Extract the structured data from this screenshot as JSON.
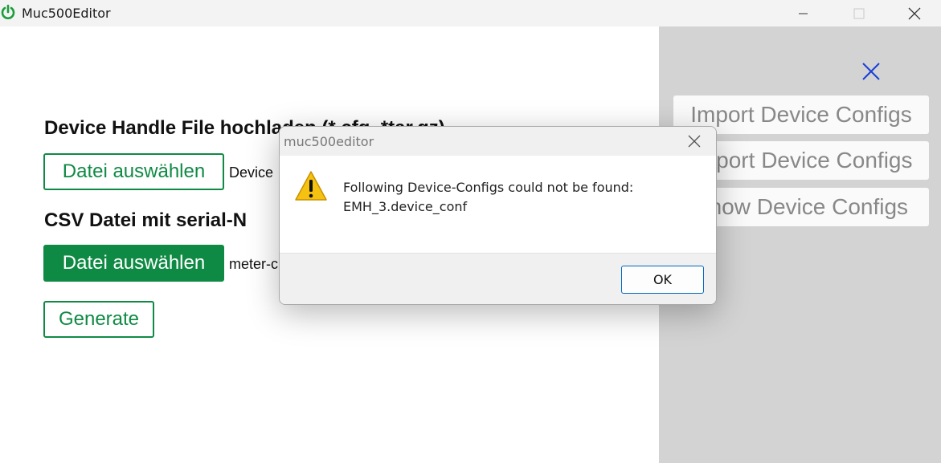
{
  "window": {
    "title": "Muc500Editor",
    "icon": "power-icon",
    "accent_color": "#1a9c3c"
  },
  "main": {
    "heading_device_file": "Device Handle File hochladen (*.cfg, *tar.gz)",
    "choose_file_button_1": "Datei auswählen",
    "file_label_1": "Device",
    "heading_csv": "CSV Datei mit serial-N",
    "choose_file_button_2": "Datei auswählen",
    "file_label_2": "meter-c",
    "generate_button": "Generate",
    "button_color": "#0f8a44"
  },
  "side_panel": {
    "close_icon": "close-icon",
    "close_icon_color": "#1a3fd8",
    "buttons": [
      "Import Device Configs",
      "Export Device Configs",
      "Show Device Configs"
    ]
  },
  "dialog": {
    "title": "muc500editor",
    "icon": "warning-icon",
    "message_line_1": "Following Device-Configs could not be found:",
    "message_line_2": "EMH_3.device_conf",
    "ok_button": "OK"
  }
}
